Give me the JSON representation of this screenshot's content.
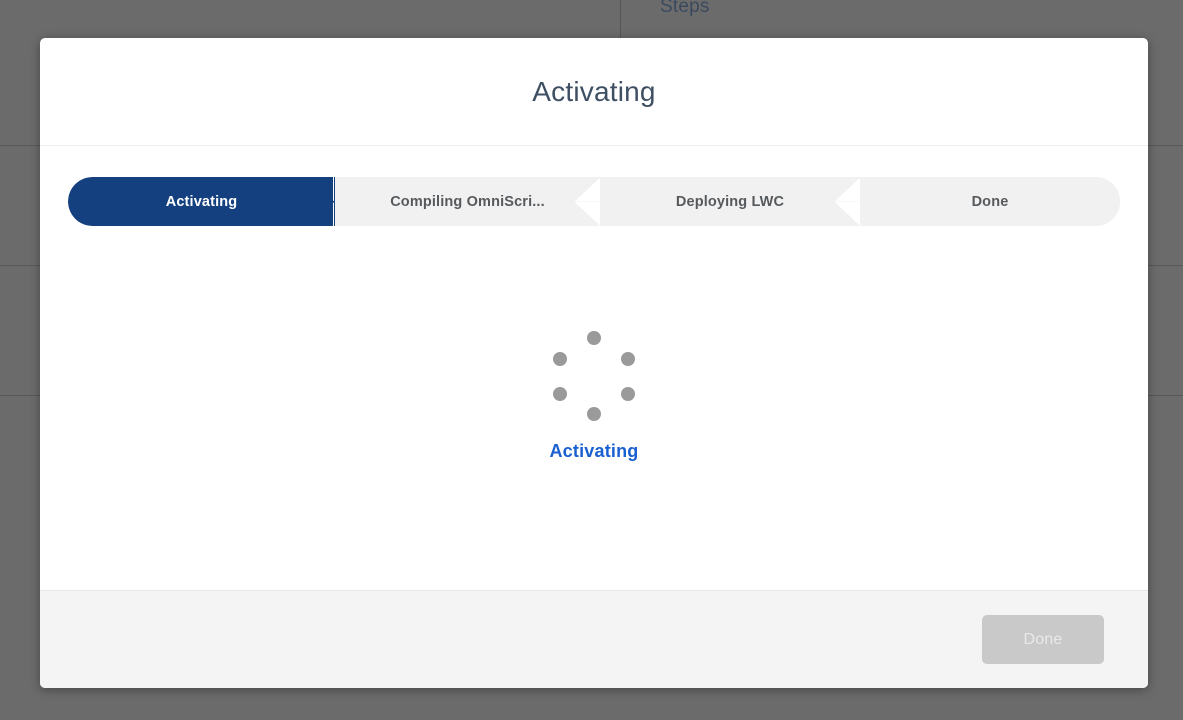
{
  "background": {
    "steps_label": "Steps",
    "overlay_color": "#6b6b6b"
  },
  "modal": {
    "title": "Activating",
    "progress": {
      "active_color": "#14407f",
      "track_color": "#f1f1f1",
      "steps": [
        {
          "label": "Activating",
          "state": "active"
        },
        {
          "label": "Compiling OmniScri...",
          "state": "upcoming"
        },
        {
          "label": "Deploying LWC",
          "state": "upcoming"
        },
        {
          "label": "Done",
          "state": "upcoming"
        }
      ]
    },
    "spinner": {
      "icon": "loading-spinner-icon",
      "dot_color": "#9a9a9a",
      "dot_count": 6
    },
    "status_text": "Activating",
    "status_color": "#1b60d0",
    "footer": {
      "done_label": "Done",
      "done_disabled": true
    }
  }
}
